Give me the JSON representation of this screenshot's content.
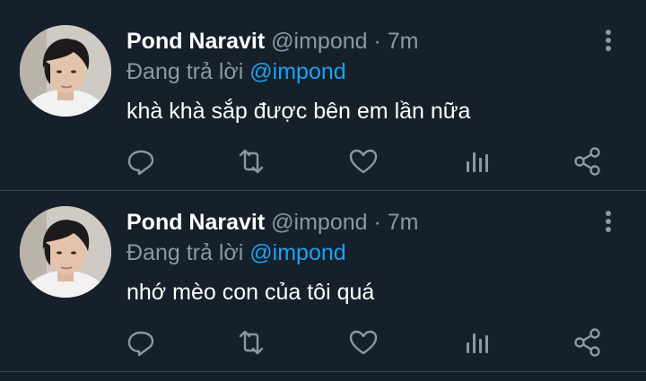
{
  "tweets": [
    {
      "author_name": "Pond Naravit",
      "handle": "@impond",
      "separator": "·",
      "time": "7m",
      "reply_prefix": "Đang trả lời",
      "reply_to": "@impond",
      "text": "khà khà sắp được bên em lần nữa"
    },
    {
      "author_name": "Pond Naravit",
      "handle": "@impond",
      "separator": "·",
      "time": "7m",
      "reply_prefix": "Đang trả lời",
      "reply_to": "@impond",
      "text": "nhớ mèo con của tôi quá"
    }
  ],
  "actions": [
    "reply-icon",
    "retweet-icon",
    "like-icon",
    "analytics-icon",
    "share-icon"
  ],
  "colors": {
    "background": "#15202b",
    "primary_text": "#ffffff",
    "secondary_text": "#8899a6",
    "link": "#1da1f2",
    "divider": "#38444d"
  }
}
